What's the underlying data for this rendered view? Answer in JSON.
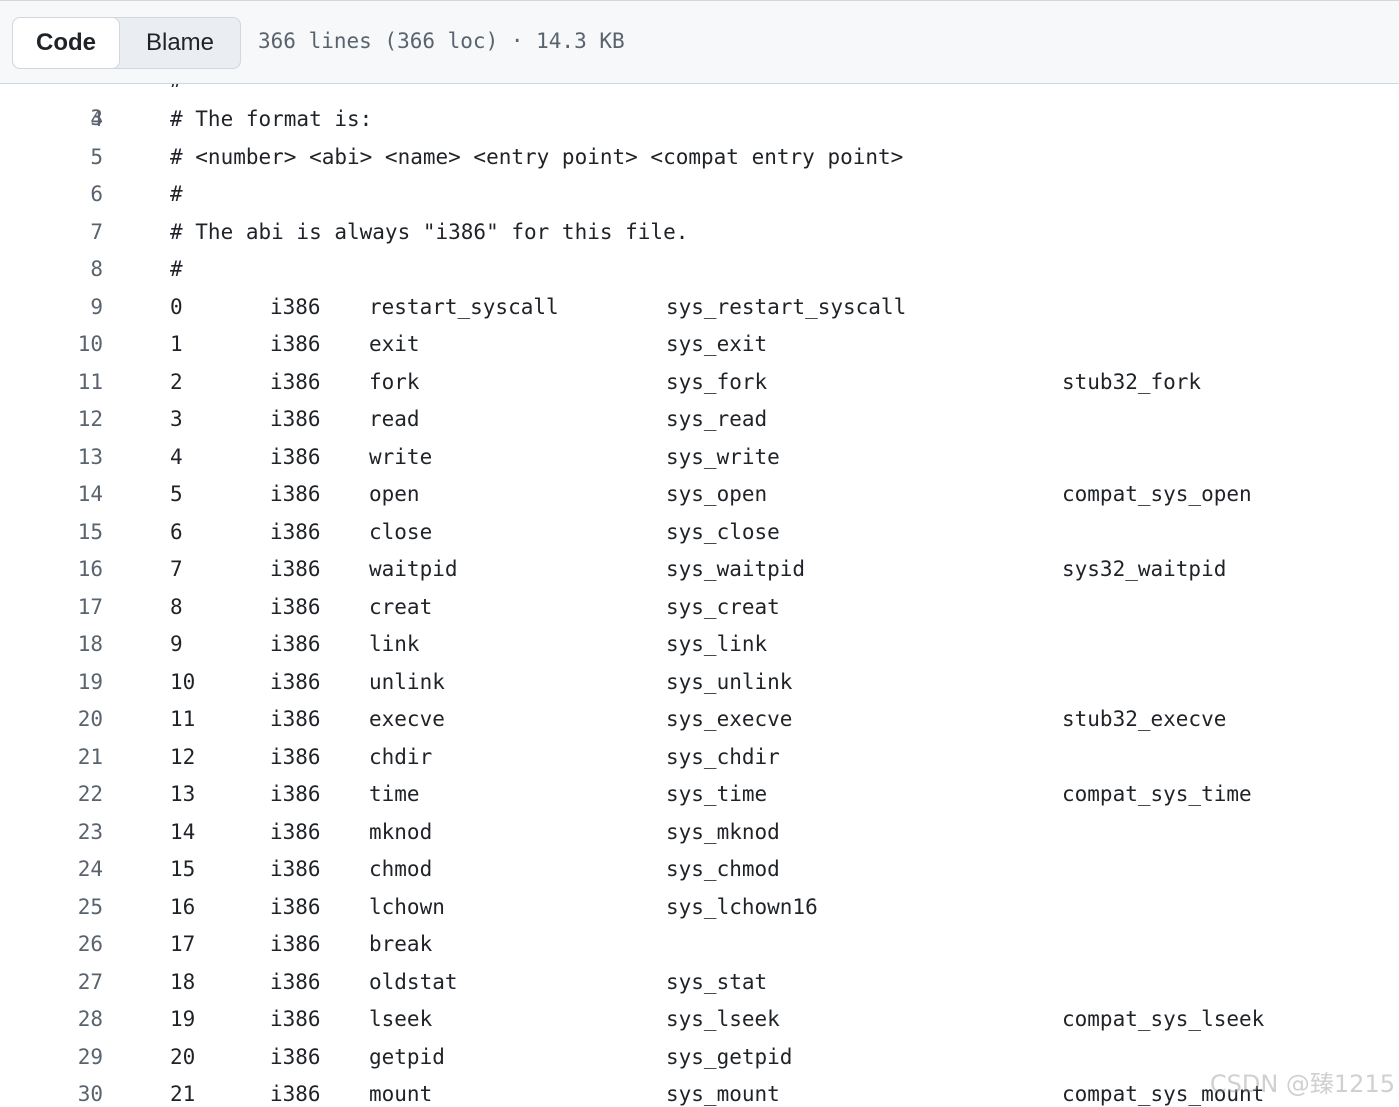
{
  "toolbar": {
    "code_label": "Code",
    "blame_label": "Blame",
    "file_info": "366 lines (366 loc) · 14.3 KB"
  },
  "partial_top": {
    "line_no": "3",
    "text": "#"
  },
  "comment_lines": [
    {
      "n": "4",
      "text": "# The format is:"
    },
    {
      "n": "5",
      "text": "# <number> <abi> <name> <entry point> <compat entry point>"
    },
    {
      "n": "6",
      "text": "#"
    },
    {
      "n": "7",
      "text": "# The abi is always \"i386\" for this file."
    },
    {
      "n": "8",
      "text": "#"
    }
  ],
  "rows": [
    {
      "n": "9",
      "num": "0",
      "abi": "i386",
      "name": "restart_syscall",
      "entry": "sys_restart_syscall",
      "compat": ""
    },
    {
      "n": "10",
      "num": "1",
      "abi": "i386",
      "name": "exit",
      "entry": "sys_exit",
      "compat": ""
    },
    {
      "n": "11",
      "num": "2",
      "abi": "i386",
      "name": "fork",
      "entry": "sys_fork",
      "compat": "stub32_fork"
    },
    {
      "n": "12",
      "num": "3",
      "abi": "i386",
      "name": "read",
      "entry": "sys_read",
      "compat": ""
    },
    {
      "n": "13",
      "num": "4",
      "abi": "i386",
      "name": "write",
      "entry": "sys_write",
      "compat": ""
    },
    {
      "n": "14",
      "num": "5",
      "abi": "i386",
      "name": "open",
      "entry": "sys_open",
      "compat": "compat_sys_open"
    },
    {
      "n": "15",
      "num": "6",
      "abi": "i386",
      "name": "close",
      "entry": "sys_close",
      "compat": ""
    },
    {
      "n": "16",
      "num": "7",
      "abi": "i386",
      "name": "waitpid",
      "entry": "sys_waitpid",
      "compat": "sys32_waitpid"
    },
    {
      "n": "17",
      "num": "8",
      "abi": "i386",
      "name": "creat",
      "entry": "sys_creat",
      "compat": ""
    },
    {
      "n": "18",
      "num": "9",
      "abi": "i386",
      "name": "link",
      "entry": "sys_link",
      "compat": ""
    },
    {
      "n": "19",
      "num": "10",
      "abi": "i386",
      "name": "unlink",
      "entry": "sys_unlink",
      "compat": ""
    },
    {
      "n": "20",
      "num": "11",
      "abi": "i386",
      "name": "execve",
      "entry": "sys_execve",
      "compat": "stub32_execve"
    },
    {
      "n": "21",
      "num": "12",
      "abi": "i386",
      "name": "chdir",
      "entry": "sys_chdir",
      "compat": ""
    },
    {
      "n": "22",
      "num": "13",
      "abi": "i386",
      "name": "time",
      "entry": "sys_time",
      "compat": "compat_sys_time"
    },
    {
      "n": "23",
      "num": "14",
      "abi": "i386",
      "name": "mknod",
      "entry": "sys_mknod",
      "compat": ""
    },
    {
      "n": "24",
      "num": "15",
      "abi": "i386",
      "name": "chmod",
      "entry": "sys_chmod",
      "compat": ""
    },
    {
      "n": "25",
      "num": "16",
      "abi": "i386",
      "name": "lchown",
      "entry": "sys_lchown16",
      "compat": ""
    },
    {
      "n": "26",
      "num": "17",
      "abi": "i386",
      "name": "break",
      "entry": "",
      "compat": ""
    },
    {
      "n": "27",
      "num": "18",
      "abi": "i386",
      "name": "oldstat",
      "entry": "sys_stat",
      "compat": ""
    },
    {
      "n": "28",
      "num": "19",
      "abi": "i386",
      "name": "lseek",
      "entry": "sys_lseek",
      "compat": "compat_sys_lseek"
    },
    {
      "n": "29",
      "num": "20",
      "abi": "i386",
      "name": "getpid",
      "entry": "sys_getpid",
      "compat": ""
    },
    {
      "n": "30",
      "num": "21",
      "abi": "i386",
      "name": "mount",
      "entry": "sys_mount",
      "compat": "compat_sys_mount"
    }
  ],
  "watermark": "CSDN @臻1215"
}
